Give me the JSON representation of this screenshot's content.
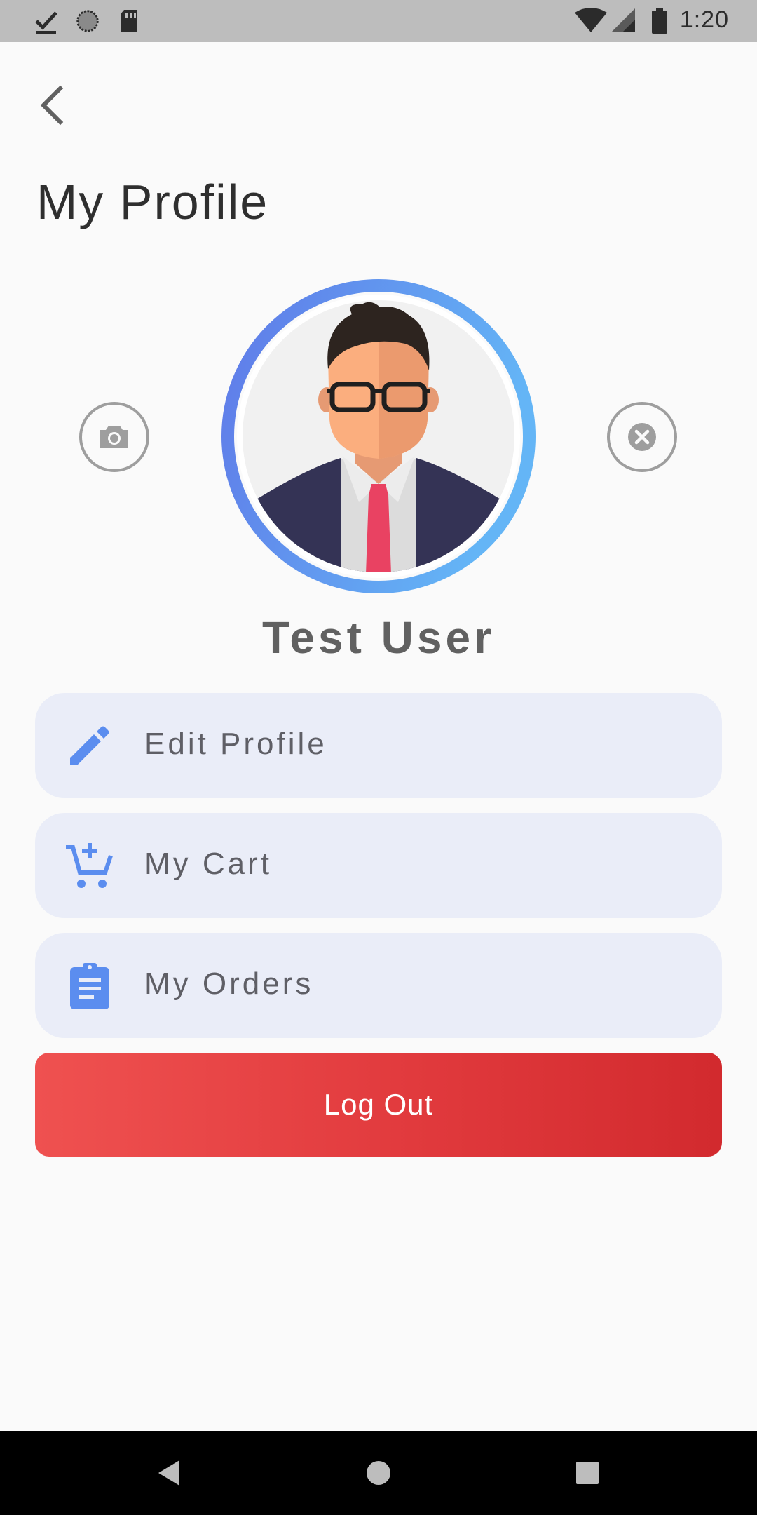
{
  "status_bar": {
    "time": "1:20",
    "icons": [
      "download-done-icon",
      "sync-icon",
      "sd-card-icon",
      "wifi-icon",
      "cellular-signal-icon",
      "battery-icon"
    ]
  },
  "header": {
    "back_icon": "chevron-left-icon",
    "title": "My Profile"
  },
  "profile": {
    "name": "Test User",
    "avatar": "businessman-avatar",
    "ring_colors": [
      "#5f7ae8",
      "#64b5f6"
    ],
    "camera_icon": "camera-icon",
    "remove_icon": "close-circle-icon"
  },
  "menu": [
    {
      "label": "Edit Profile",
      "icon": "pencil-icon"
    },
    {
      "label": "My Cart",
      "icon": "cart-add-icon"
    },
    {
      "label": "My Orders",
      "icon": "clipboard-list-icon"
    }
  ],
  "logout": {
    "label": "Log Out"
  },
  "colors": {
    "accent": "#5b8def",
    "menu_bg": "#eaedf8",
    "logout_start": "#ef5150",
    "logout_end": "#d22a2e"
  },
  "nav_bar": {
    "buttons": [
      "back-triangle-icon",
      "home-circle-icon",
      "recents-square-icon"
    ]
  }
}
